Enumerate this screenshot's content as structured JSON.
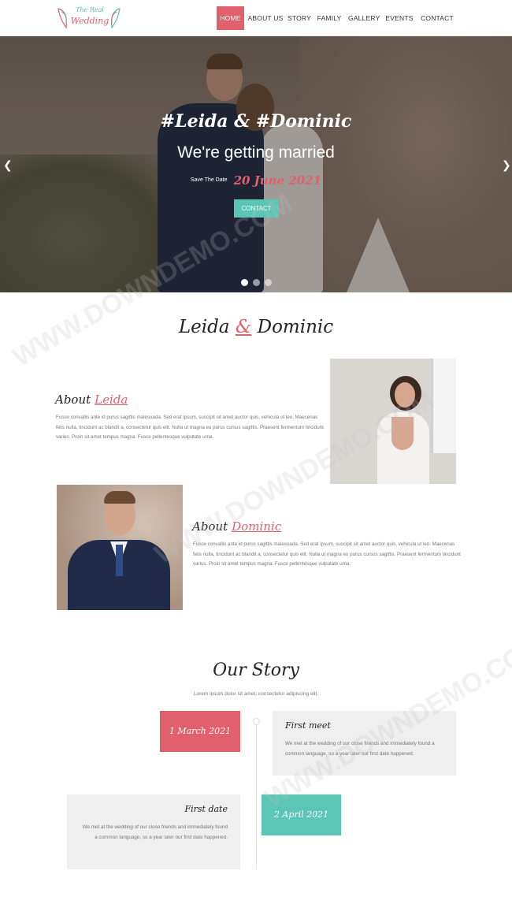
{
  "brand": {
    "logo_line1": "The Real",
    "logo_line2": "Wedding"
  },
  "nav": {
    "items": [
      "HOME",
      "ABOUT US",
      "STORY",
      "FAMILY",
      "GALLERY",
      "EVENTS",
      "CONTACT"
    ],
    "active_index": 0
  },
  "hero": {
    "title": "#Leida & #Dominic",
    "subtitle": "We're getting married",
    "save_label": "Save The Date",
    "date": "20 June 2021",
    "button": "CONTACT",
    "prev_icon": "chevron-left-icon",
    "next_icon": "chevron-right-icon",
    "slides": 3,
    "active_slide": 0
  },
  "couple": {
    "title_left": "Leida",
    "title_amp": "&",
    "title_right": "Dominic",
    "bride": {
      "about_label": "About",
      "name": "Leida",
      "text": "Fusce convallis ante id purus sagittis malesuada. Sed erat ipsum, suscipit sit amet auctor quis, vehicula ut leo. Maecenas felis nulla, tincidunt ac blandit a, consectetur quis elit. Nulla ut magna eu purus cursus sagittis. Praesent fermentum tincidunt varius. Proin sit amet tempus magna. Fusce pellentesque vulputate urna."
    },
    "groom": {
      "about_label": "About",
      "name": "Dominic",
      "text": "Fusce convallis ante id purus sagittis malesuada. Sed erat ipsum, suscipit sit amet auctor quis, vehicula ut leo. Maecenas felis nulla, tincidunt ac blandit a, consectetur quis elit. Nulla ut magna eu purus cursus sagittis. Praesent fermentum tincidunt varius. Proin sit amet tempus magna. Fusce pellentesque vulputate urna."
    }
  },
  "story": {
    "title": "Our Story",
    "subtitle": "Lorem ipsum dolor sit amet, consectetur adipiscing elit.",
    "events": [
      {
        "date": "1 March 2021",
        "title": "First meet",
        "text": "We met at the wedding of our close friends and immediately found a common language, so a year later our first date happened."
      },
      {
        "date": "2 April 2021",
        "title": "First date",
        "text": "We met at the wedding of our close friends and immediately found a common language, so a year later our first date happened."
      }
    ]
  },
  "watermark": {
    "text": "WWW.DOWNDEMO.COM"
  },
  "colors": {
    "accent": "#e0616b",
    "teal": "#5cc6b6",
    "card_bg": "#efefef"
  }
}
